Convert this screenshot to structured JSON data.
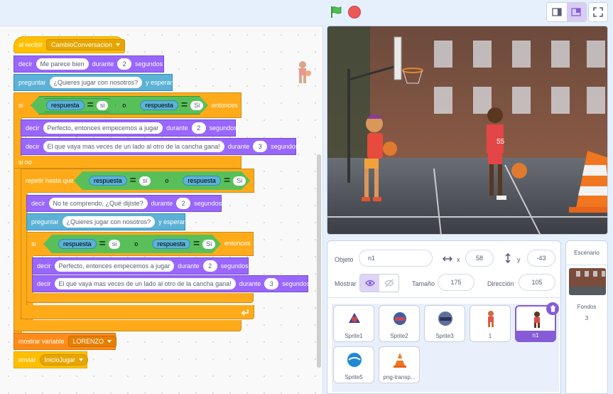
{
  "toolbar": {
    "green_flag_icon": "green-flag-icon",
    "stop_icon": "stop-icon"
  },
  "colors": {
    "events": "#ffbf00",
    "looks": "#9966ff",
    "sensing": "#5cb1d6",
    "control": "#ffab19",
    "operators": "#59c059",
    "variables": "#ff8c1a",
    "accent": "#855cd6"
  },
  "script": {
    "hat_label": "al recibir",
    "hat_message": "CambioConversacion",
    "b1": {
      "label": "decir",
      "text": "Me parece bien",
      "mid": "durante",
      "secs": "2",
      "end": "segundos"
    },
    "b2": {
      "label": "preguntar",
      "text": "¿Quieres jugar con nosotros?",
      "end": "y esperar"
    },
    "if1": {
      "label": "si",
      "var1": "respuesta",
      "eq": "=",
      "val1": "si",
      "or": "o",
      "var2": "respuesta",
      "val2": "Si",
      "end": "entonces"
    },
    "b3": {
      "label": "decir",
      "text": "Perfecto, entonces empecemos a jugar",
      "mid": "durante",
      "secs": "2",
      "end": "segundos"
    },
    "b4": {
      "label": "decir",
      "text": "El que vaya mas veces de un lado al otro de la cancha gana!",
      "mid": "durante",
      "secs": "3",
      "end": "segundos"
    },
    "else_label": "si no",
    "rep": {
      "label": "repetir hasta que",
      "var1": "respuesta",
      "eq": "=",
      "val1": "si",
      "or": "o",
      "var2": "respuesta",
      "val2": "Si"
    },
    "b5": {
      "label": "decir",
      "text": "No te comprendo, ¿Qué dijiste?",
      "mid": "durante",
      "secs": "2",
      "end": "segundos"
    },
    "b6": {
      "label": "preguntar",
      "text": "¿Quieres jugar con nosotros?",
      "end": "y esperar"
    },
    "if2": {
      "label": "si",
      "var1": "respuesta",
      "eq": "=",
      "val1": "si",
      "or": "o",
      "var2": "respuesta",
      "val2": "Si",
      "end": "entonces"
    },
    "b7": {
      "label": "decir",
      "text": "Perfecto, entonces empecemos a jugar",
      "mid": "durante",
      "secs": "2",
      "end": "segundos"
    },
    "b8": {
      "label": "decir",
      "text": "El que vaya mas veces de un lado al otro de la cancha gana!",
      "mid": "durante",
      "secs": "3",
      "end": "segundos"
    },
    "show_var": {
      "label": "mostrar variable",
      "var": "LORENZO"
    },
    "broadcast": {
      "label": "enviar",
      "msg": "InicioJugar"
    }
  },
  "sprite_info": {
    "object_label": "Objeto",
    "name": "n1",
    "x_label": "x",
    "x": "58",
    "y_label": "y",
    "y": "-43",
    "show_label": "Mostrar",
    "size_label": "Tamaño",
    "size": "175",
    "direction_label": "Dirección",
    "direction": "105"
  },
  "sprites": [
    {
      "name": "Sprite1",
      "icon": "logo-icon"
    },
    {
      "name": "Sprite2",
      "icon": "logo-icon"
    },
    {
      "name": "Sprite3",
      "icon": "logo-icon"
    },
    {
      "name": "1",
      "icon": "player-icon"
    },
    {
      "name": "n1",
      "icon": "player-icon",
      "selected": true
    },
    {
      "name": "Sprite5",
      "icon": "badge-icon"
    },
    {
      "name": "png-transp...",
      "icon": "cone-icon"
    }
  ],
  "stage_pane": {
    "title": "Escenario",
    "backdrops_label": "Fondos",
    "backdrops_count": "3"
  }
}
